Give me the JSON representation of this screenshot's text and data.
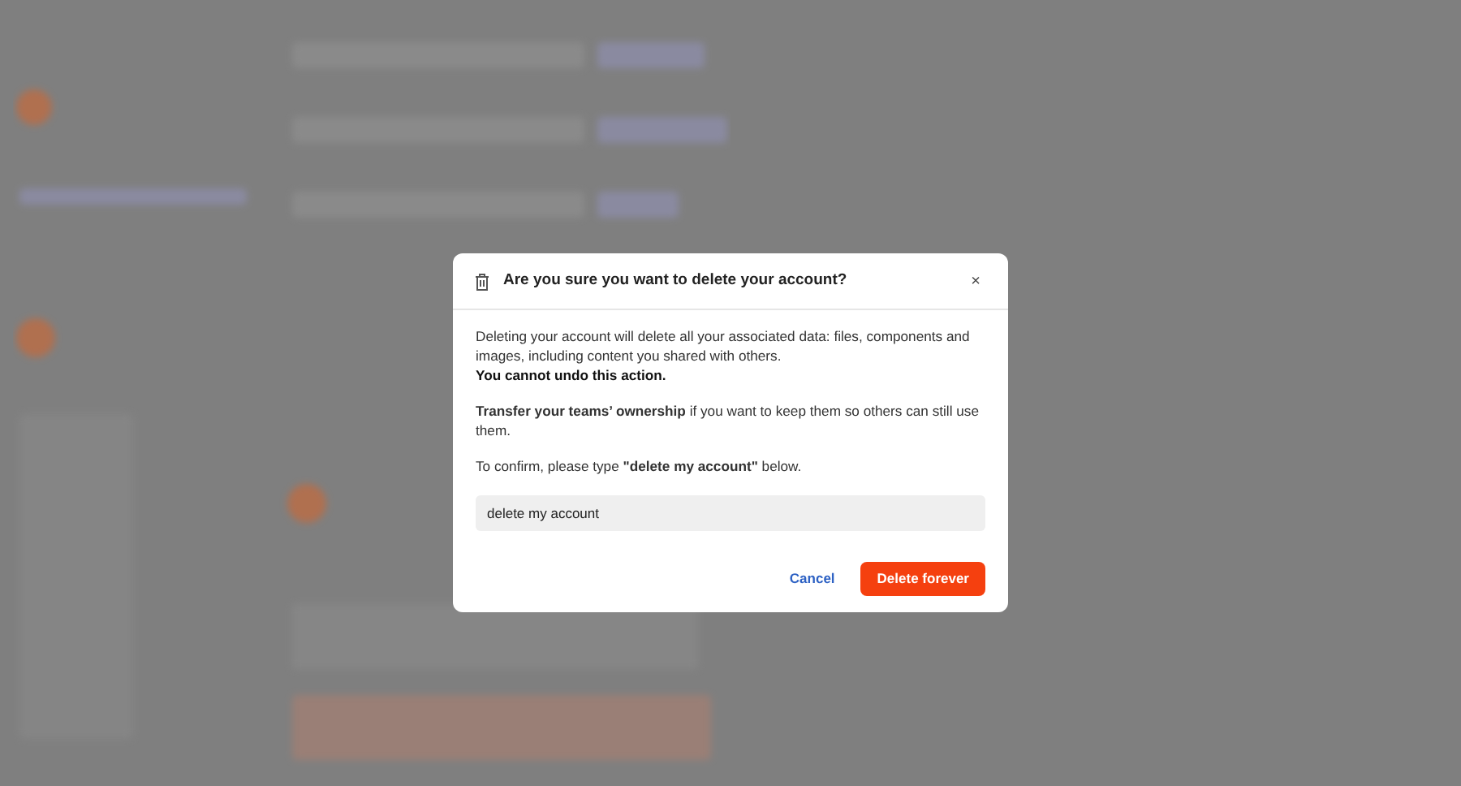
{
  "dialog": {
    "title": "Are you sure you want to delete your account?",
    "close": "×",
    "paragraphs": [
      {
        "kind": "text",
        "text": "Deleting your account will delete all your associated data: files, components and images, including content you shared with others."
      },
      {
        "kind": "warning",
        "text": "You cannot undo this action."
      },
      {
        "kind": "spaced",
        "text": "**Transfer your teams’ ownership** if you want to keep them so others can still use them."
      },
      {
        "kind": "spaced",
        "text": "To confirm, please type **\"delete my account\"** below."
      }
    ],
    "confirm_field": {
      "value": "delete my account"
    },
    "buttons": [
      {
        "kind": "link",
        "label": "Cancel"
      },
      {
        "kind": "danger",
        "label": "Delete forever"
      }
    ]
  }
}
